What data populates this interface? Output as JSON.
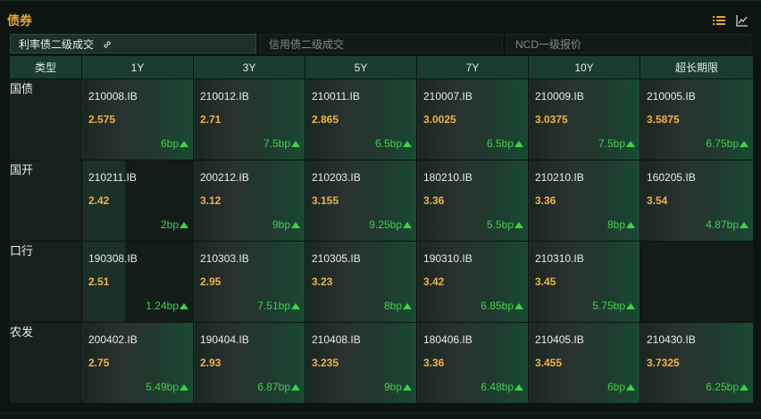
{
  "header": {
    "title": "债券",
    "icons": [
      "list-icon",
      "line-chart-icon"
    ],
    "accent": "#e8a53b"
  },
  "tabs": [
    {
      "label": "利率债二级成交",
      "active": true
    },
    {
      "label": "信用债二级成交",
      "active": false
    },
    {
      "label": "NCD一级报价",
      "active": false
    }
  ],
  "table": {
    "corner": "类型",
    "columns": [
      "1Y",
      "3Y",
      "5Y",
      "7Y",
      "10Y",
      "超长期限"
    ],
    "rows": [
      {
        "type": "国债",
        "cells": [
          {
            "code": "210008.IB",
            "yield": "2.575",
            "bp": "6bp"
          },
          {
            "code": "210012.IB",
            "yield": "2.71",
            "bp": "7.5bp"
          },
          {
            "code": "210011.IB",
            "yield": "2.865",
            "bp": "6.5bp"
          },
          {
            "code": "210007.IB",
            "yield": "3.0025",
            "bp": "6.5bp"
          },
          {
            "code": "210009.IB",
            "yield": "3.0375",
            "bp": "7.5bp"
          },
          {
            "code": "210005.IB",
            "yield": "3.5875",
            "bp": "6.75bp"
          }
        ]
      },
      {
        "type": "国开",
        "cells": [
          {
            "code": "210211.IB",
            "yield": "2.42",
            "bp": "2bp"
          },
          {
            "code": "200212.IB",
            "yield": "3.12",
            "bp": "9bp"
          },
          {
            "code": "210203.IB",
            "yield": "3.155",
            "bp": "9.25bp"
          },
          {
            "code": "180210.IB",
            "yield": "3.36",
            "bp": "5.5bp"
          },
          {
            "code": "210210.IB",
            "yield": "3.36",
            "bp": "8bp"
          },
          {
            "code": "160205.IB",
            "yield": "3.54",
            "bp": "4.87bp"
          }
        ]
      },
      {
        "type": "口行",
        "cells": [
          {
            "code": "190308.IB",
            "yield": "2.51",
            "bp": "1.24bp"
          },
          {
            "code": "210303.IB",
            "yield": "2.95",
            "bp": "7.51bp"
          },
          {
            "code": "210305.IB",
            "yield": "3.23",
            "bp": "8bp"
          },
          {
            "code": "190310.IB",
            "yield": "3.42",
            "bp": "6.85bp"
          },
          {
            "code": "210310.IB",
            "yield": "3.45",
            "bp": "5.75bp"
          },
          null
        ]
      },
      {
        "type": "农发",
        "cells": [
          {
            "code": "200402.IB",
            "yield": "2.75",
            "bp": "5.49bp"
          },
          {
            "code": "190404.IB",
            "yield": "2.93",
            "bp": "6.87bp"
          },
          {
            "code": "210408.IB",
            "yield": "3.235",
            "bp": "9bp"
          },
          {
            "code": "180406.IB",
            "yield": "3.36",
            "bp": "6.48bp"
          },
          {
            "code": "210405.IB",
            "yield": "3.455",
            "bp": "6bp"
          },
          {
            "code": "210430.IB",
            "yield": "3.7325",
            "bp": "6.25bp"
          }
        ]
      }
    ]
  },
  "colors": {
    "yield": "#f0b14a",
    "bp_up": "#3ed14a",
    "header_bg": "#1a3d33"
  }
}
